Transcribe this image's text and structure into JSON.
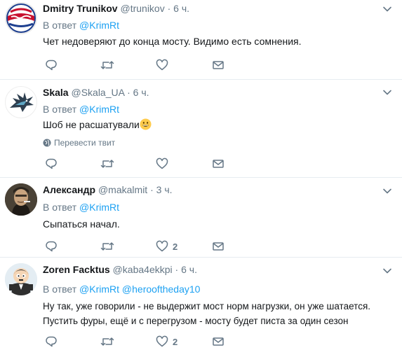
{
  "tweets": [
    {
      "name": "Dmitry Trunikov",
      "handle": "@trunikov",
      "dot": "·",
      "time": "6 ч.",
      "reply_prefix": "В ответ",
      "mentions": [
        "@KrimRt"
      ],
      "text": "Чет недоверяют до конца мосту. Видимо есть сомнения.",
      "like_count": "",
      "avatar": "pepsi-cola-logo"
    },
    {
      "name": "Skala",
      "handle": "@Skala_UA",
      "dot": "·",
      "time": "6 ч.",
      "reply_prefix": "В ответ",
      "mentions": [
        "@KrimRt"
      ],
      "text": "Шоб не расшатували",
      "translate": "Перевести твит",
      "like_count": "",
      "avatar": "eagle-logo"
    },
    {
      "name": "Александр",
      "handle": "@makalmit",
      "dot": "·",
      "time": "3 ч.",
      "reply_prefix": "В ответ",
      "mentions": [
        "@KrimRt"
      ],
      "text": "Сыпаться начал.",
      "like_count": "2",
      "avatar": "man-smoking-photo"
    },
    {
      "name": "Zoren Facktus",
      "handle": "@kaba4ekkpi",
      "dot": "·",
      "time": "6 ч.",
      "reply_prefix": "В ответ",
      "mentions": [
        "@KrimRt",
        "@herooftheday10"
      ],
      "text": "Ну так, уже говорили - не выдержит мост норм нагрузки, он уже шатается. Пустить фуры, ещё и с перегрузом - мосту будет писта за один сезон",
      "like_count": "2",
      "avatar": "cartoon-character"
    }
  ],
  "colors": {
    "accent": "#1da1f2",
    "muted": "#657786",
    "text": "#14171a",
    "divider": "#e6ecf0"
  }
}
